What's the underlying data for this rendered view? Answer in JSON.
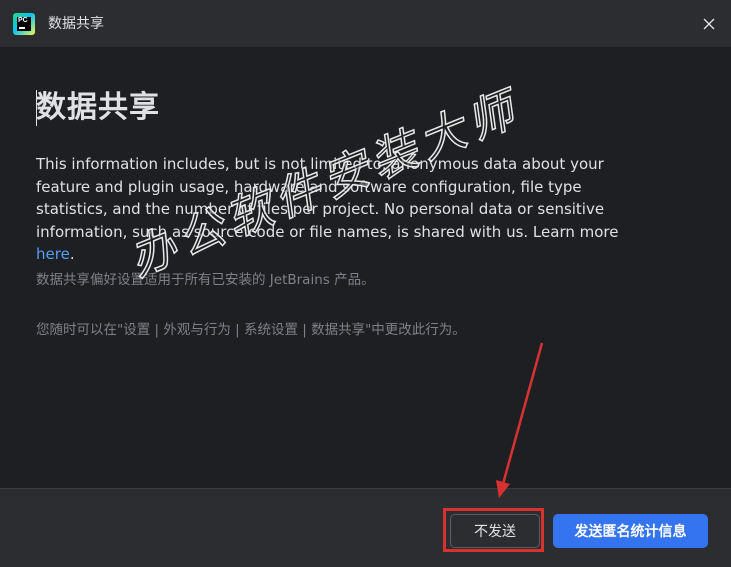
{
  "window": {
    "title": "数据共享",
    "logo_text": "PC"
  },
  "content": {
    "heading": "数据共享",
    "description_text": "This information includes, but is not limited to, anonymous data about your feature and plugin usage, hardware and software configuration, file type statistics, and the number of files per project. No personal data or sensitive information, such as source code or file names, is shared with us. Learn more ",
    "learn_more_link": "here",
    "description_end": ".",
    "note_1": "数据共享偏好设置适用于所有已安装的 JetBrains 产品。",
    "note_2": "您随时可以在\"设置 | 外观与行为 | 系统设置 | 数据共享\"中更改此行为。"
  },
  "watermark": {
    "text": "办公软件安装大师"
  },
  "footer": {
    "decline_label": "不发送",
    "accept_label": "发送匿名统计信息"
  },
  "colors": {
    "background": "#1e1f22",
    "panel": "#2b2d30",
    "text": "#dfe1e5",
    "muted": "#7e8187",
    "link": "#589df6",
    "primary": "#3574f0",
    "annotation": "#d8312f"
  },
  "icons": {
    "logo": "pycharm-logo-icon",
    "close": "close-icon"
  }
}
